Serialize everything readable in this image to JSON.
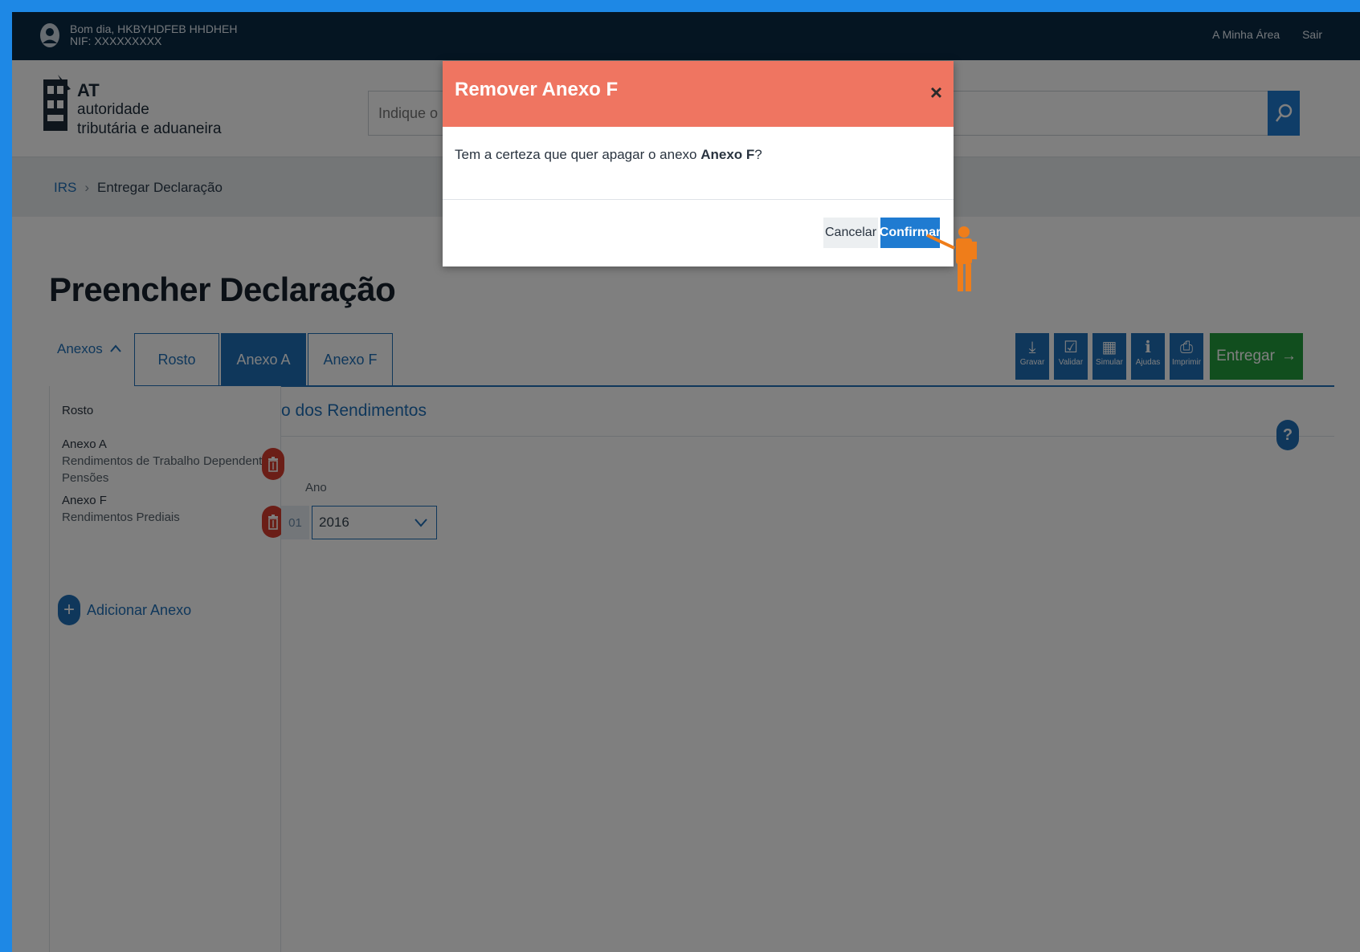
{
  "topbar": {
    "greeting": "Bom dia, HKBYHDFEB HHDHEH",
    "nif": "NIF: XXXXXXXXX",
    "my_area": "A Minha Área",
    "logout": "Sair"
  },
  "header": {
    "logo_line1": "AT",
    "logo_line2": "autoridade",
    "logo_line3": "tributária e aduaneira",
    "search_placeholder": "Indique o"
  },
  "breadcrumb": {
    "root": "IRS",
    "current": "Entregar Declaração"
  },
  "page": {
    "title": "Preencher Declaração"
  },
  "tabs": {
    "annexes_toggle": "Anexos",
    "items": [
      "Rosto",
      "Anexo A",
      "Anexo F"
    ],
    "active": "Anexo A"
  },
  "toolbar": {
    "save": "Gravar",
    "validate": "Validar",
    "simulate": "Simular",
    "help": "Ajudas",
    "print": "Imprimir",
    "submit": "Entregar"
  },
  "sidebar": {
    "rosto": "Rosto",
    "anexo_a_title": "Anexo A",
    "anexo_a_sub1": "Rendimentos de Trabalho Dependente e",
    "anexo_a_sub2": "Pensões",
    "anexo_f_title": "Anexo F",
    "anexo_f_sub": "Rendimentos Prediais",
    "add_annex": "Adicionar Anexo"
  },
  "main": {
    "section_title": "o dos Rendimentos",
    "help_glyph": "?",
    "year_label": "Ano",
    "year_field_num": "01",
    "year_value": "2016"
  },
  "modal": {
    "title": "Remover Anexo F",
    "close_glyph": "×",
    "body_prefix": "Tem a certeza que quer apagar o anexo ",
    "body_bold": "Anexo F",
    "body_suffix": "?",
    "cancel": "Cancelar",
    "confirm": "Confirmar"
  },
  "colors": {
    "primary": "#1f6fb7",
    "modal_header": "#ef7561",
    "submit_green": "#229c3d",
    "danger": "#d63c2f",
    "topbar": "#0b2a45",
    "page_border": "#1e88e5"
  }
}
